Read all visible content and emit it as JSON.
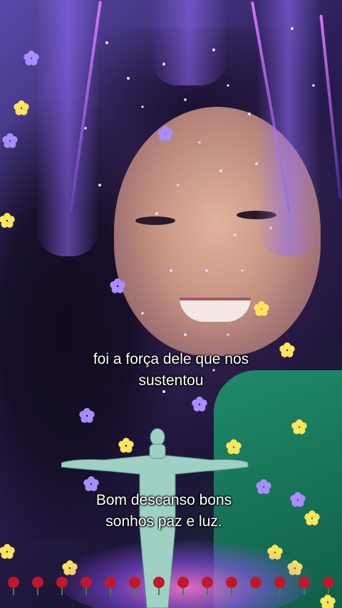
{
  "captions": {
    "line1": "foi a força dele que nos",
    "line2": "sustentou",
    "line3": "Bom descanso bons",
    "line4": "sonhos paz e luz."
  },
  "icons": {
    "statue": "christ-the-redeemer-statue-icon",
    "rose": "rose-icon",
    "flower": "flower-icon"
  },
  "colors": {
    "accent_purple": "#9b6bff",
    "flower_yellow": "#ffe45c",
    "rose_red": "#c0182a",
    "shirt_green": "#1f8a6a"
  }
}
